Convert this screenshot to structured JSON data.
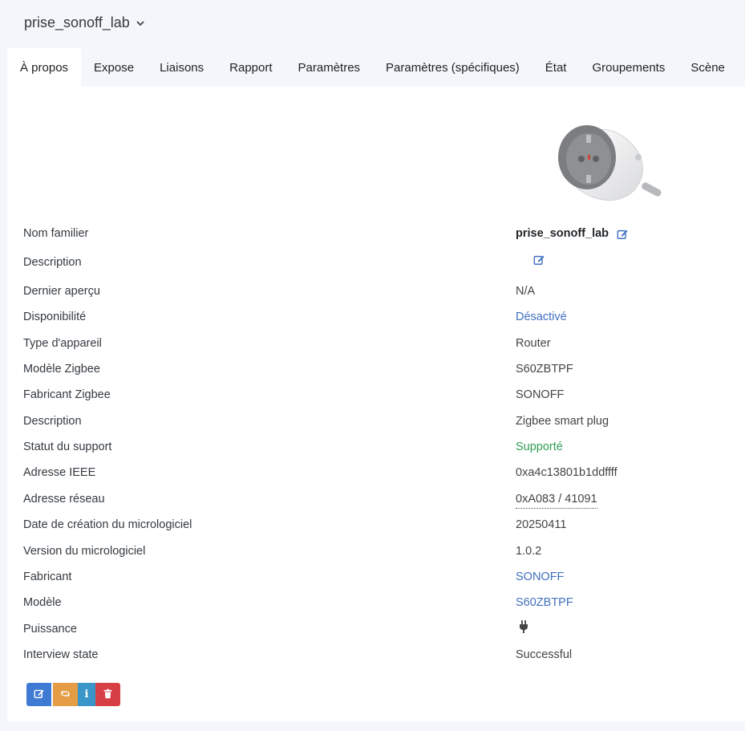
{
  "header": {
    "device_name": "prise_sonoff_lab"
  },
  "tabs": [
    {
      "label": "À propos"
    },
    {
      "label": "Expose"
    },
    {
      "label": "Liaisons"
    },
    {
      "label": "Rapport"
    },
    {
      "label": "Paramètres"
    },
    {
      "label": "Paramètres (spécifiques)"
    },
    {
      "label": "État"
    },
    {
      "label": "Groupements"
    },
    {
      "label": "Scène"
    }
  ],
  "rows": [
    {
      "label": "Nom familier",
      "value": "prise_sonoff_lab"
    },
    {
      "label": "Description",
      "value": ""
    },
    {
      "label": "Dernier aperçu",
      "value": "N/A"
    },
    {
      "label": "Disponibilité",
      "value": "Désactivé"
    },
    {
      "label": "Type d'appareil",
      "value": "Router"
    },
    {
      "label": "Modèle Zigbee",
      "value": "S60ZBTPF"
    },
    {
      "label": "Fabricant Zigbee",
      "value": "SONOFF"
    },
    {
      "label": "Description",
      "value": "Zigbee smart plug"
    },
    {
      "label": "Statut du support",
      "value": "Supporté"
    },
    {
      "label": "Adresse IEEE",
      "value": "0xa4c13801b1ddffff"
    },
    {
      "label": "Adresse réseau",
      "value": "0xA083 / 41091"
    },
    {
      "label": "Date de création du micrologiciel",
      "value": "20250411"
    },
    {
      "label": "Version du micrologiciel",
      "value": "1.0.2"
    },
    {
      "label": "Fabricant",
      "value": "SONOFF"
    },
    {
      "label": "Modèle",
      "value": "S60ZBTPF"
    },
    {
      "label": "Puissance",
      "value": "",
      "icon": "plug-icon"
    },
    {
      "label": "Interview state",
      "value": "Successful"
    }
  ],
  "actions": {
    "edit_icon": "edit-icon",
    "interview_icon": "retweet-icon",
    "info_label": "i",
    "delete_icon": "trash-icon"
  },
  "colors": {
    "link": "#3f6fbf",
    "success": "#2f9e54",
    "btn_edit": "#3f7bd4",
    "btn_interview": "#e49d45",
    "btn_info": "#3a95c9",
    "btn_delete": "#d64045"
  }
}
